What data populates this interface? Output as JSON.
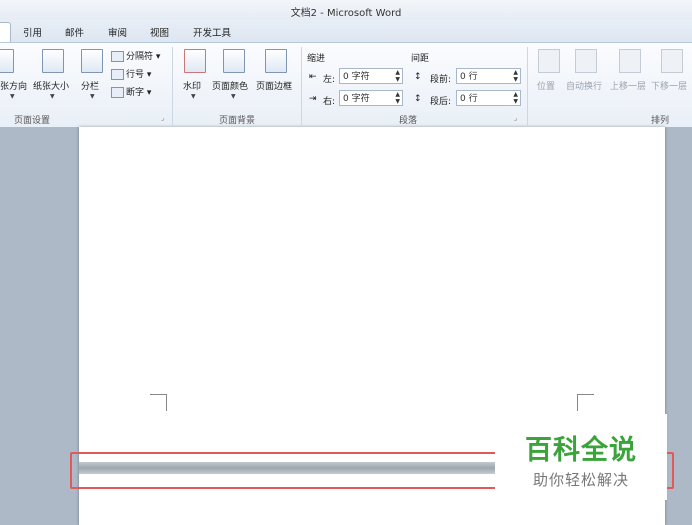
{
  "window": {
    "title": "文档2 - Microsoft Word"
  },
  "tabs": [
    {
      "label": "引用"
    },
    {
      "label": "邮件"
    },
    {
      "label": "审阅"
    },
    {
      "label": "视图"
    },
    {
      "label": "开发工具"
    }
  ],
  "ribbon": {
    "page_setup": {
      "label": "页面设置",
      "direction": "张方向",
      "size": "纸张大小",
      "columns": "分栏",
      "breaks": "分隔符",
      "line_numbers": "行号",
      "hyphenation": "断字"
    },
    "page_background": {
      "label": "页面背景",
      "watermark": "水印",
      "page_color": "页面颜色",
      "page_border": "页面边框"
    },
    "paragraph": {
      "label": "段落",
      "indent_header": "缩进",
      "spacing_header": "间距",
      "indent_left_label": "左:",
      "indent_left_value": "0 字符",
      "indent_right_label": "右:",
      "indent_right_value": "0 字符",
      "spacing_before_label": "段前:",
      "spacing_before_value": "0 行",
      "spacing_after_label": "段后:",
      "spacing_after_value": "0 行"
    },
    "arrange": {
      "label": "排列",
      "position": "位置",
      "wrap_text": "自动换行",
      "bring_forward": "上移一层",
      "send_backward": "下移一层"
    }
  },
  "watermark_overlay": {
    "title": "百科全说",
    "subtitle": "助你轻松解决"
  }
}
